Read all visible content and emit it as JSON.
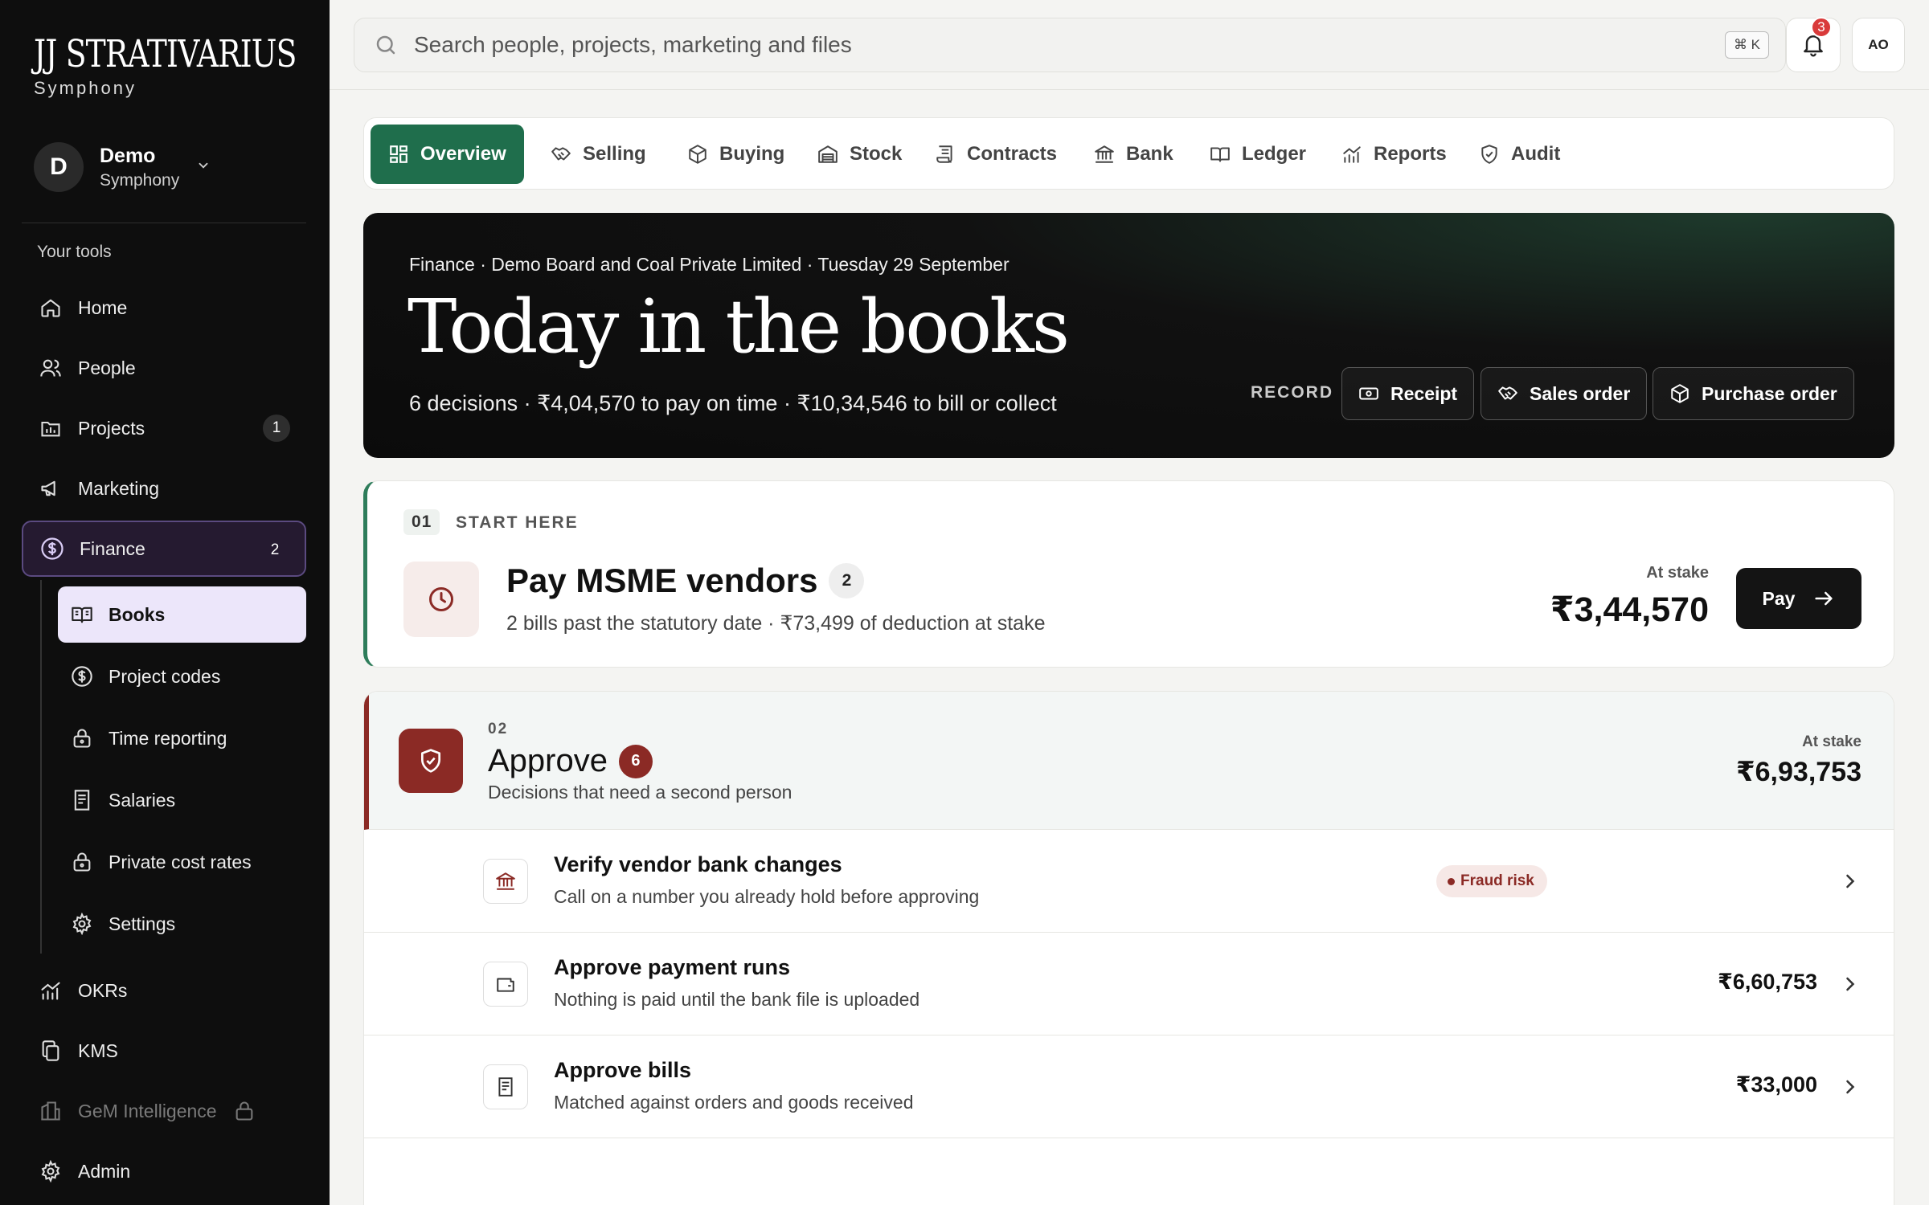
{
  "brand": {
    "name": "JJ STRATIVARIUS",
    "sub": "Symphony"
  },
  "workspace": {
    "initial": "D",
    "name": "Demo",
    "sub": "Symphony"
  },
  "sidebar": {
    "section_label": "Your tools",
    "items": [
      {
        "label": "Home",
        "icon": "home-icon"
      },
      {
        "label": "People",
        "icon": "people-icon"
      },
      {
        "label": "Projects",
        "icon": "projects-icon",
        "badge": "1"
      },
      {
        "label": "Marketing",
        "icon": "megaphone-icon"
      },
      {
        "label": "Finance",
        "icon": "dollar-icon",
        "badge": "2",
        "active": true
      }
    ],
    "finance_sub": [
      {
        "label": "Books",
        "icon": "book-icon",
        "active": true
      },
      {
        "label": "Project codes",
        "icon": "dollar-icon"
      },
      {
        "label": "Time reporting",
        "icon": "lock-icon"
      },
      {
        "label": "Salaries",
        "icon": "receipt-icon"
      },
      {
        "label": "Private cost rates",
        "icon": "lock-icon"
      },
      {
        "label": "Settings",
        "icon": "gear-icon"
      }
    ],
    "bottom_items": [
      {
        "label": "OKRs",
        "icon": "chart-icon"
      },
      {
        "label": "KMS",
        "icon": "copy-icon"
      },
      {
        "label": "GeM Intelligence",
        "icon": "building-icon",
        "locked": true
      },
      {
        "label": "Admin",
        "icon": "gear-icon"
      }
    ]
  },
  "search": {
    "placeholder": "Search people, projects, marketing and files",
    "shortcut": "⌘ K"
  },
  "notifications": {
    "count": "3"
  },
  "user": {
    "initials": "AO"
  },
  "tabs": [
    {
      "label": "Overview",
      "icon": "grid-icon",
      "active": true
    },
    {
      "label": "Selling",
      "icon": "handshake-icon"
    },
    {
      "label": "Buying",
      "icon": "box-icon"
    },
    {
      "label": "Stock",
      "icon": "warehouse-icon"
    },
    {
      "label": "Contracts",
      "icon": "scroll-icon"
    },
    {
      "label": "Bank",
      "icon": "bank-icon"
    },
    {
      "label": "Ledger",
      "icon": "book-icon"
    },
    {
      "label": "Reports",
      "icon": "chart-icon"
    },
    {
      "label": "Audit",
      "icon": "shield-check-icon"
    }
  ],
  "hero": {
    "meta": "Finance · Demo Board and Coal Private Limited · Tuesday 29 September",
    "title": "Today in the books",
    "summary": "6 decisions · ₹4,04,570 to pay on time · ₹10,34,546 to bill or collect",
    "record_label": "RECORD",
    "buttons": [
      {
        "label": "Receipt",
        "icon": "cash-icon"
      },
      {
        "label": "Sales order",
        "icon": "handshake-icon"
      },
      {
        "label": "Purchase order",
        "icon": "box-icon"
      }
    ]
  },
  "start": {
    "num": "01",
    "label": "START HERE",
    "title": "Pay MSME vendors",
    "badge": "2",
    "subtitle": "2 bills past the statutory date · ₹73,499 of deduction at stake",
    "stake_label": "At stake",
    "stake_value": "₹3,44,570",
    "action": "Pay"
  },
  "approve": {
    "num": "02",
    "title": "Approve",
    "badge": "6",
    "subtitle": "Decisions that need a second person",
    "stake_label": "At stake",
    "stake_value": "₹6,93,753",
    "rows": [
      {
        "title": "Verify vendor bank changes",
        "sub": "Call on a number you already hold before approving",
        "tag": "Fraud risk",
        "icon": "bank-icon"
      },
      {
        "title": "Approve payment runs",
        "sub": "Nothing is paid until the bank file is uploaded",
        "amount": "₹6,60,753",
        "icon": "wallet-icon"
      },
      {
        "title": "Approve bills",
        "sub": "Matched against orders and goods received",
        "amount": "₹33,000",
        "icon": "receipt-icon"
      }
    ]
  }
}
